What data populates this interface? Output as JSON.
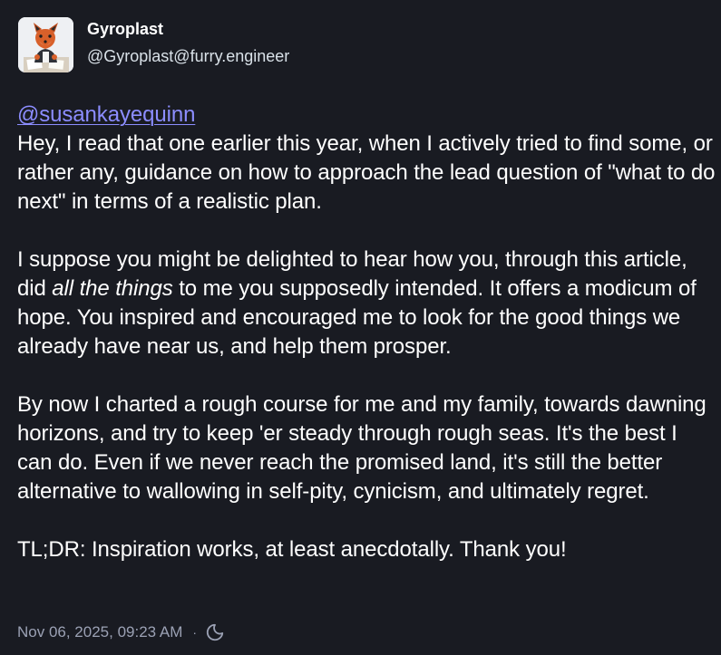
{
  "author": {
    "display_name": "Gyroplast",
    "handle": "@Gyroplast@furry.engineer",
    "avatar_icon": "fox-character-avatar"
  },
  "post": {
    "mention": "@susankayequinn",
    "p1_text": "Hey, I read that one earlier this year, when I actively tried to find some, or rather any, guidance on how to approach the lead question of \"what to do next\" in terms of a realistic plan.",
    "p2_before": "I suppose you might be delighted to hear how you, through this article, did ",
    "p2_emphasis": "all the things",
    "p2_after": " to me you supposedly intended. It offers a modicum of hope. You inspired and encouraged me to look for the good things we already have near us, and help them prosper.",
    "p3": "By now I charted a rough course for me and my family, towards dawning horizons, and try to keep 'er steady through rough seas. It's the best I can do. Even if we never reach the promised land, it's still the better alternative to wallowing in self-pity, cynicism, and ultimately regret.",
    "p4": "TL;DR: Inspiration works, at least anecdotally. Thank you!"
  },
  "footer": {
    "timestamp": "Nov 06, 2025, 09:23 AM",
    "separator": "·",
    "visibility_icon": "moon-icon"
  },
  "colors": {
    "background": "#191b22",
    "text": "#ffffff",
    "mention": "#8c8dff",
    "muted": "#9ba1b4"
  }
}
